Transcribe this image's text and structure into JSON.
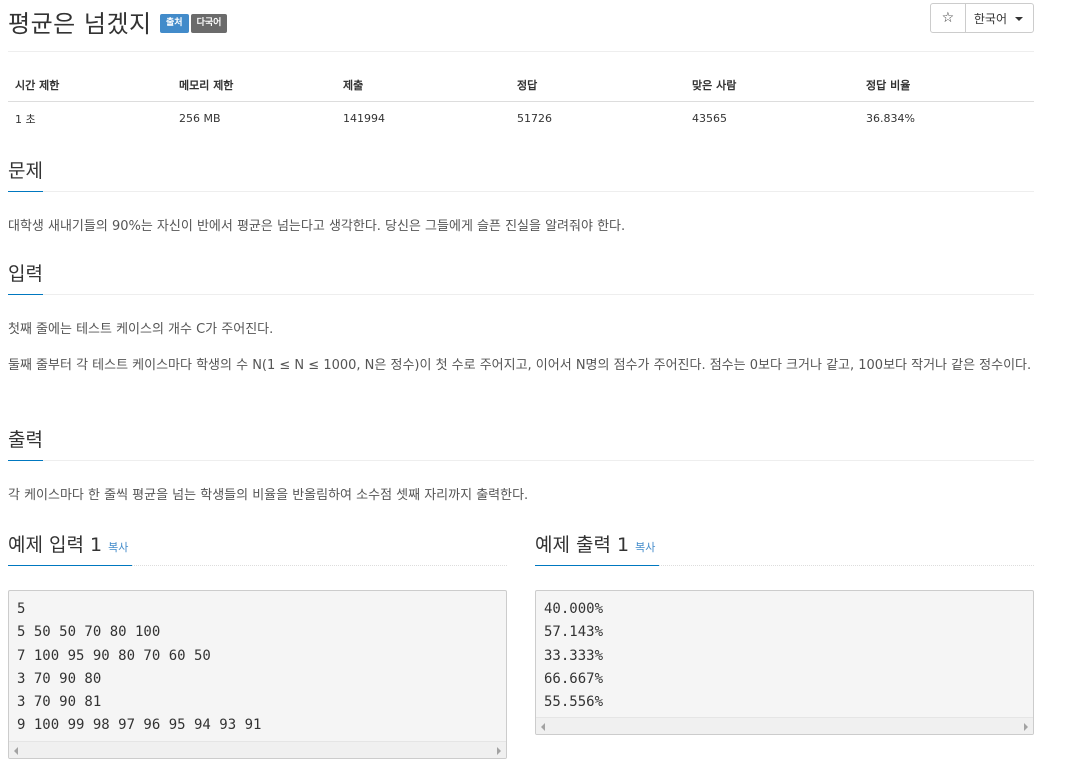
{
  "problem": {
    "title": "평균은 넘겠지",
    "badges": [
      "출처",
      "다국어"
    ]
  },
  "toolbar": {
    "star_icon": "☆",
    "language": "한국어"
  },
  "info": {
    "headers": [
      "시간 제한",
      "메모리 제한",
      "제출",
      "정답",
      "맞은 사람",
      "정답 비율"
    ],
    "values": [
      "1 초",
      "256 MB",
      "141994",
      "51726",
      "43565",
      "36.834%"
    ]
  },
  "sections": {
    "problem_title": "문제",
    "problem_text": "대학생 새내기들의 90%는 자신이 반에서 평균은 넘는다고 생각한다. 당신은 그들에게 슬픈 진실을 알려줘야 한다.",
    "input_title": "입력",
    "input_text_1": "첫째 줄에는 테스트 케이스의 개수 C가 주어진다.",
    "input_text_2": "둘째 줄부터 각 테스트 케이스마다 학생의 수 N(1 ≤ N ≤ 1000, N은 정수)이 첫 수로 주어지고, 이어서 N명의 점수가 주어진다. 점수는 0보다 크거나 같고, 100보다 작거나 같은 정수이다.",
    "output_title": "출력",
    "output_text": "각 케이스마다 한 줄씩 평균을 넘는 학생들의 비율을 반올림하여 소수점 셋째 자리까지 출력한다."
  },
  "samples": {
    "input_title": "예제 입력 1",
    "output_title": "예제 출력 1",
    "copy_label": "복사",
    "input_lines": [
      "5",
      "5 50 50 70 80 100",
      "7 100 95 90 80 70 60 50",
      "3 70 90 80",
      "3 70 90 81",
      "9 100 99 98 97 96 95 94 93 91"
    ],
    "output_lines": [
      "40.000%",
      "57.143%",
      "33.333%",
      "66.667%",
      "55.556%"
    ]
  }
}
